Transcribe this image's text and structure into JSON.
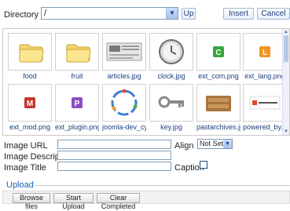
{
  "toolbar": {
    "directory_label": "Directory",
    "directory_value": "/",
    "up_label": "Up",
    "insert_label": "Insert",
    "cancel_label": "Cancel"
  },
  "browser": {
    "items": [
      {
        "label": "food",
        "icon": "folder-icon"
      },
      {
        "label": "fruit",
        "icon": "folder-icon"
      },
      {
        "label": "articles.jpg",
        "icon": "image-thumb"
      },
      {
        "label": "clock.jpg",
        "icon": "image-thumb"
      },
      {
        "label": "ext_com.png",
        "icon": "image-thumb",
        "letter": "C",
        "color": "#3aa63a"
      },
      {
        "label": "ext_lang.png",
        "icon": "image-thumb",
        "letter": "L",
        "color": "#f29424"
      },
      {
        "label": "ext_mod.png",
        "icon": "image-thumb",
        "letter": "M",
        "color": "#c4372c"
      },
      {
        "label": "ext_plugin.png",
        "icon": "image-thumb",
        "letter": "P",
        "color": "#8a4fbf"
      },
      {
        "label": "joomla-dev_cycle",
        "icon": "image-thumb"
      },
      {
        "label": "key.jpg",
        "icon": "image-thumb"
      },
      {
        "label": "pastarchives.jpg",
        "icon": "image-thumb"
      },
      {
        "label": "powered_by.png",
        "icon": "image-thumb"
      }
    ]
  },
  "form": {
    "image_url_label": "Image URL",
    "image_description_label": "Image Description",
    "image_title_label": "Image Title",
    "align_label": "Align",
    "align_value": "Not Set",
    "caption_label": "Caption"
  },
  "upload": {
    "title": "Upload",
    "browse_label": "Browse files",
    "start_label": "Start Upload",
    "clear_label": "Clear Completed"
  }
}
